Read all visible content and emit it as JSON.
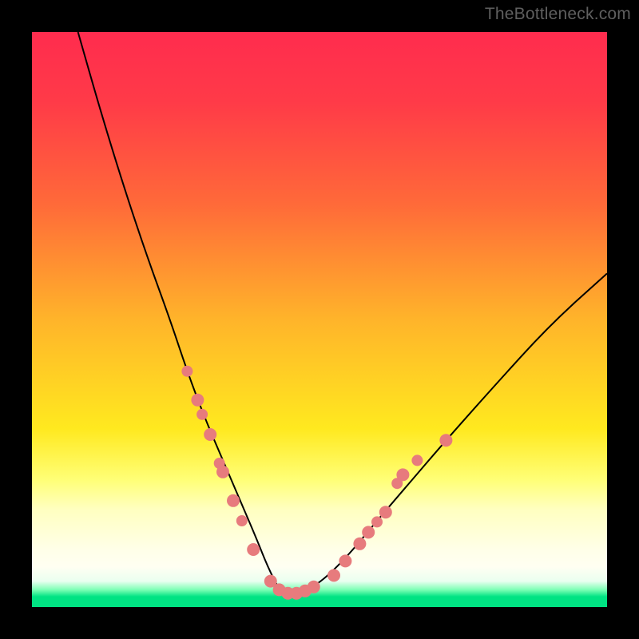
{
  "watermark": "TheBottleneck.com",
  "chart_data": {
    "type": "line",
    "title": "",
    "xlabel": "",
    "ylabel": "",
    "xlim": [
      0,
      100
    ],
    "ylim": [
      0,
      100
    ],
    "grid": false,
    "notes": "Bottleneck-style V-curve over rainbow vertical gradient (red top -> green bottom). Minimum near x≈43, y≈2. Salmon circular markers clustered on both arms of the V in the lower (yellow/green) region.",
    "series": [
      {
        "name": "bottleneck-curve",
        "x": [
          8,
          12,
          16,
          20,
          24,
          27,
          30,
          33,
          36,
          39,
          41,
          43,
          44,
          46,
          48,
          51,
          55,
          60,
          66,
          72,
          80,
          90,
          100
        ],
        "y": [
          100,
          86,
          73,
          61,
          50,
          41,
          33,
          26,
          19,
          12,
          7,
          3,
          2,
          2,
          3,
          5,
          9,
          15,
          22,
          29,
          38,
          49,
          58
        ]
      }
    ],
    "markers": {
      "name": "highlighted-points",
      "color": "#e77b7d",
      "points": [
        {
          "x": 27.0,
          "y": 41.0,
          "r": 7
        },
        {
          "x": 28.8,
          "y": 36.0,
          "r": 8
        },
        {
          "x": 29.6,
          "y": 33.5,
          "r": 7
        },
        {
          "x": 31.0,
          "y": 30.0,
          "r": 8
        },
        {
          "x": 32.6,
          "y": 25.0,
          "r": 7
        },
        {
          "x": 33.2,
          "y": 23.5,
          "r": 8
        },
        {
          "x": 35.0,
          "y": 18.5,
          "r": 8
        },
        {
          "x": 36.5,
          "y": 15.0,
          "r": 7
        },
        {
          "x": 38.5,
          "y": 10.0,
          "r": 8
        },
        {
          "x": 41.5,
          "y": 4.5,
          "r": 8
        },
        {
          "x": 43.0,
          "y": 3.0,
          "r": 8
        },
        {
          "x": 44.5,
          "y": 2.4,
          "r": 8
        },
        {
          "x": 46.0,
          "y": 2.4,
          "r": 8
        },
        {
          "x": 47.5,
          "y": 2.8,
          "r": 8
        },
        {
          "x": 49.0,
          "y": 3.5,
          "r": 8
        },
        {
          "x": 52.5,
          "y": 5.5,
          "r": 8
        },
        {
          "x": 54.5,
          "y": 8.0,
          "r": 8
        },
        {
          "x": 57.0,
          "y": 11.0,
          "r": 8
        },
        {
          "x": 58.5,
          "y": 13.0,
          "r": 8
        },
        {
          "x": 60.0,
          "y": 14.8,
          "r": 7
        },
        {
          "x": 61.5,
          "y": 16.5,
          "r": 8
        },
        {
          "x": 63.5,
          "y": 21.5,
          "r": 7
        },
        {
          "x": 64.5,
          "y": 23.0,
          "r": 8
        },
        {
          "x": 67.0,
          "y": 25.5,
          "r": 7
        },
        {
          "x": 72.0,
          "y": 29.0,
          "r": 8
        }
      ]
    }
  }
}
